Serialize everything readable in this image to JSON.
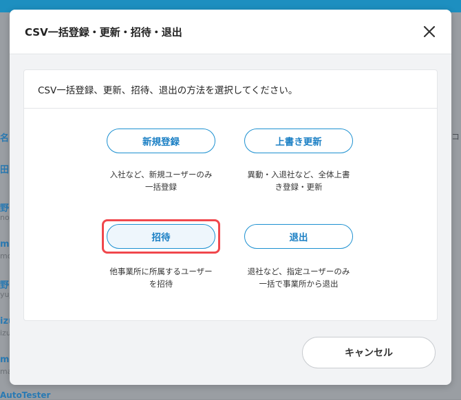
{
  "background": {
    "left_items": [
      {
        "text": "名",
        "sub": ""
      },
      {
        "text": "田",
        "sub": ""
      },
      {
        "text": "野",
        "sub": "noj"
      },
      {
        "text": "mo",
        "sub": "mo"
      },
      {
        "text": "野",
        "sub": "yuj"
      },
      {
        "text": "izu",
        "sub": "izu"
      },
      {
        "text": "ma",
        "sub": "ma"
      }
    ],
    "right_text": "コ",
    "bottom_text": "AutoTester"
  },
  "modal": {
    "title": "CSV一括登録・更新・招待・退出",
    "close_icon": "close-icon",
    "panel_heading": "CSV一括登録、更新、招待、退出の方法を選択してください。",
    "options": [
      {
        "label": "新規登録",
        "desc_line1": "入社など、新規ユーザーのみ",
        "desc_line2": "一括登録",
        "selected": false
      },
      {
        "label": "上書き更新",
        "desc_line1": "異動・入退社など、全体上書",
        "desc_line2": "き登録・更新",
        "selected": false
      },
      {
        "label": "招待",
        "desc_line1": "他事業所に所属するユーザー",
        "desc_line2": "を招待",
        "selected": true
      },
      {
        "label": "退出",
        "desc_line1": "退社など、指定ユーザーのみ",
        "desc_line2": "一括で事業所から退出",
        "selected": false
      }
    ],
    "cancel_label": "キャンセル"
  },
  "colors": {
    "accent": "#1a8fd0",
    "highlight": "#f0474c"
  }
}
